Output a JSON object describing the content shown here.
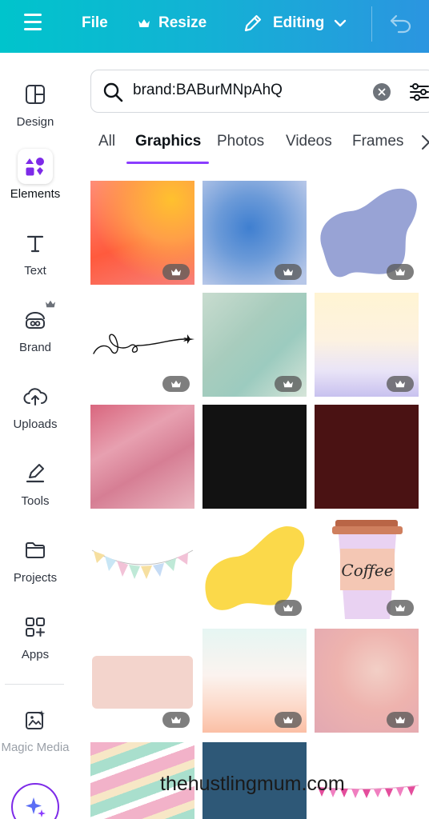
{
  "topbar": {
    "file_label": "File",
    "resize_label": "Resize",
    "editing_label": "Editing"
  },
  "sidebar": {
    "items": [
      {
        "label": "Design",
        "icon": "layout-icon"
      },
      {
        "label": "Elements",
        "icon": "shapes-icon"
      },
      {
        "label": "Text",
        "icon": "text-icon"
      },
      {
        "label": "Brand",
        "icon": "brand-icon"
      },
      {
        "label": "Uploads",
        "icon": "cloud-upload-icon"
      },
      {
        "label": "Tools",
        "icon": "pen-icon"
      },
      {
        "label": "Projects",
        "icon": "folder-icon"
      },
      {
        "label": "Apps",
        "icon": "apps-icon"
      },
      {
        "label": "Magic Media",
        "icon": "magic-media-icon"
      }
    ]
  },
  "search": {
    "value": "brand:BABurMNpAhQ"
  },
  "tabs": [
    "All",
    "Graphics",
    "Photos",
    "Videos",
    "Frames"
  ],
  "active_tab": "Graphics",
  "grid": {
    "coffee_text": "Coffee"
  },
  "watermark": "thehustlingmum.com",
  "colors": {
    "accent": "#8b3dff",
    "topbar_start": "#00c4cc",
    "topbar_end": "#2b95e0"
  }
}
